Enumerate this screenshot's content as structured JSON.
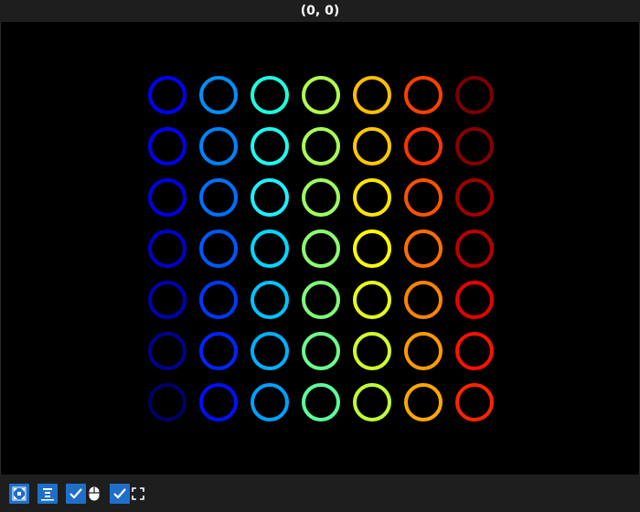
{
  "window": {
    "title": "(0, 0)"
  },
  "grid": {
    "rows": 7,
    "columns": 7,
    "colors": [
      [
        "#0000ff",
        "#008fff",
        "#1fffdf",
        "#b0ff4f",
        "#ffbf00",
        "#ff4000",
        "#7a0000"
      ],
      [
        "#0000f6",
        "#0083ff",
        "#20f9ef",
        "#a8ff57",
        "#ffc800",
        "#ff3300",
        "#870000"
      ],
      [
        "#0000e4",
        "#0070ff",
        "#1ff0ff",
        "#9cff62",
        "#ffe600",
        "#ff5200",
        "#a00000"
      ],
      [
        "#0000cc",
        "#0058ff",
        "#00d8ff",
        "#8cff6e",
        "#ffff00",
        "#ff6e00",
        "#b80000"
      ],
      [
        "#0000b4",
        "#0038ff",
        "#00c4ff",
        "#7fff7a",
        "#e6ff1a",
        "#ff8400",
        "#e60000"
      ],
      [
        "#000090",
        "#0024ff",
        "#00b0ff",
        "#6eff8a",
        "#d0ff2e",
        "#ff9a00",
        "#ff1000"
      ],
      [
        "#00006a",
        "#0010ff",
        "#00a0ff",
        "#5cff9a",
        "#c0ff38",
        "#ffa800",
        "#ff2400"
      ]
    ]
  },
  "toolbar": {
    "buttons": [
      {
        "name": "fit-view-icon",
        "active": true
      },
      {
        "name": "align-center-icon",
        "active": true
      },
      {
        "name": "checkbox-mouse",
        "checked": true
      },
      {
        "name": "checkbox-fullscreen",
        "checked": true
      }
    ]
  }
}
